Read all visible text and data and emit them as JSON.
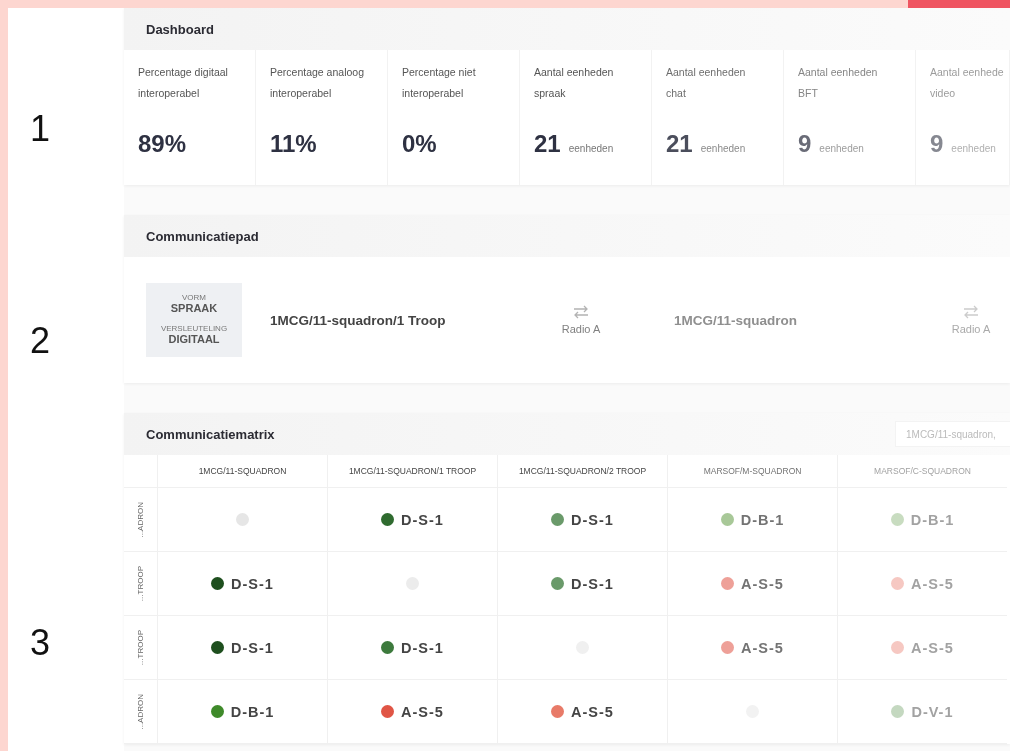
{
  "side_numbers": [
    "1",
    "2",
    "3"
  ],
  "dashboard": {
    "title": "Dashboard",
    "stats": [
      {
        "label": "Percentage digitaal interoperabel",
        "value": "89%"
      },
      {
        "label": "Percentage analoog interoperabel",
        "value": "11%"
      },
      {
        "label": "Percentage niet interoperabel",
        "value": "0%"
      },
      {
        "label": "Aantal eenheden spraak",
        "value": "21",
        "unit": "eenheden"
      },
      {
        "label": "Aantal eenheden chat",
        "value": "21",
        "unit": "eenheden"
      },
      {
        "label": "Aantal eenheden BFT",
        "value": "9",
        "unit": "eenheden"
      },
      {
        "label": "Aantal eenhede video",
        "value": "9",
        "unit": "eenheden"
      }
    ]
  },
  "path": {
    "title": "Communicatiepad",
    "form_label": "VORM",
    "form": "SPRAAK",
    "encryption_label": "VERSLEUTELING",
    "encryption": "DIGITAAL",
    "hops": [
      {
        "kind": "unit",
        "name": "1MCG/11-squadron/1 Troop"
      },
      {
        "kind": "link",
        "name": "Radio A"
      },
      {
        "kind": "unit",
        "name": "1MCG/11-squadron"
      },
      {
        "kind": "link",
        "name": "Radio A"
      }
    ]
  },
  "matrix": {
    "title": "Communicatiematrix",
    "filter": "1MCG/11-squadron,",
    "columns": [
      "1MCG/11-SQUADRON",
      "1MCG/11-SQUADRON/1 TROOP",
      "1MCG/11-SQUADRON/2 TROOP",
      "MARSOF/M-SQUADRON",
      "MARSOF/C-SQUADRON"
    ],
    "rows": [
      {
        "label": "...ADRON",
        "cells": [
          {
            "kind": "empty",
            "color": "#e6e6e6"
          },
          {
            "kind": "code",
            "code": "D-S-1",
            "color": "#2f6b2f"
          },
          {
            "kind": "code",
            "code": "D-S-1",
            "color": "#6a9a6a"
          },
          {
            "kind": "code",
            "code": "D-B-1",
            "color": "#a8c898"
          },
          {
            "kind": "code",
            "code": "D-B-1",
            "color": "#c8dcc0"
          }
        ]
      },
      {
        "label": "...TROOP",
        "cells": [
          {
            "kind": "code",
            "code": "D-S-1",
            "color": "#1e4f1e"
          },
          {
            "kind": "empty",
            "color": "#ececec"
          },
          {
            "kind": "code",
            "code": "D-S-1",
            "color": "#6a9a6a"
          },
          {
            "kind": "code",
            "code": "A-S-5",
            "color": "#eea098"
          },
          {
            "kind": "code",
            "code": "A-S-5",
            "color": "#f6c8c2"
          }
        ]
      },
      {
        "label": "...TROOP",
        "cells": [
          {
            "kind": "code",
            "code": "D-S-1",
            "color": "#1e4f1e"
          },
          {
            "kind": "code",
            "code": "D-S-1",
            "color": "#3d7a3d"
          },
          {
            "kind": "empty",
            "color": "#f0f0f0"
          },
          {
            "kind": "code",
            "code": "A-S-5",
            "color": "#eea098"
          },
          {
            "kind": "code",
            "code": "A-S-5",
            "color": "#f6c8c2"
          }
        ]
      },
      {
        "label": "...ADRON",
        "cells": [
          {
            "kind": "code",
            "code": "D-B-1",
            "color": "#3f8a2a"
          },
          {
            "kind": "code",
            "code": "A-S-5",
            "color": "#e05545"
          },
          {
            "kind": "code",
            "code": "A-S-5",
            "color": "#e87a68"
          },
          {
            "kind": "empty",
            "color": "#f2f2f2"
          },
          {
            "kind": "code",
            "code": "D-V-1",
            "color": "#c4d8c0"
          }
        ]
      }
    ]
  }
}
